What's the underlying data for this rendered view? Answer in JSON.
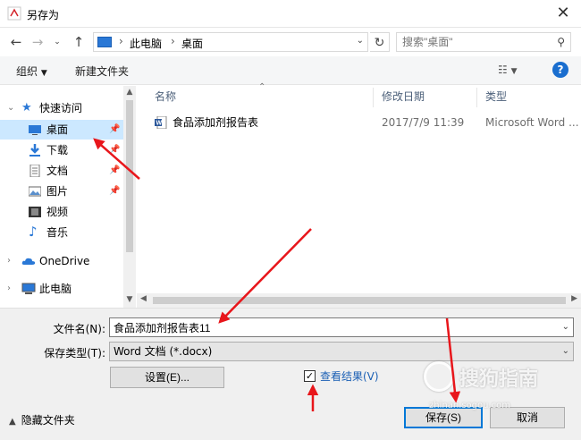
{
  "window": {
    "title": "另存为"
  },
  "nav": {
    "breadcrumb": [
      "此电脑",
      "桌面"
    ],
    "search_placeholder": "搜索\"桌面\""
  },
  "toolbar": {
    "organize": "组织",
    "new_folder": "新建文件夹"
  },
  "sidebar": {
    "quick_access": "快速访问",
    "items": [
      {
        "label": "桌面",
        "icon": "desktop-icon",
        "pinned": true,
        "selected": true
      },
      {
        "label": "下载",
        "icon": "download-icon",
        "pinned": true
      },
      {
        "label": "文档",
        "icon": "document-icon",
        "pinned": true
      },
      {
        "label": "图片",
        "icon": "picture-icon",
        "pinned": true
      },
      {
        "label": "视频",
        "icon": "video-icon",
        "pinned": false
      },
      {
        "label": "音乐",
        "icon": "music-icon",
        "pinned": false
      }
    ],
    "onedrive": "OneDrive",
    "this_pc": "此电脑"
  },
  "filelist": {
    "columns": {
      "name": "名称",
      "date": "修改日期",
      "type": "类型"
    },
    "rows": [
      {
        "name": "食品添加剂报告表",
        "date": "2017/7/9 11:39",
        "type": "Microsoft Word ..."
      }
    ]
  },
  "form": {
    "filename_label": "文件名(N):",
    "filename_value": "食品添加剂报告表11",
    "savetype_label": "保存类型(T):",
    "savetype_value": "Word 文档 (*.docx)",
    "settings_button": "设置(E)...",
    "view_result_label": "查看结果(V)",
    "view_result_checked": true,
    "save_button": "保存(S)",
    "cancel_button": "取消",
    "hide_folders": "隐藏文件夹"
  },
  "watermark": {
    "text": "搜狗指南",
    "sub": "zhinan.sogou.com"
  },
  "colors": {
    "accent": "#0078d7",
    "selected_bg": "#cce8ff",
    "annotation_red": "#e8161b"
  }
}
